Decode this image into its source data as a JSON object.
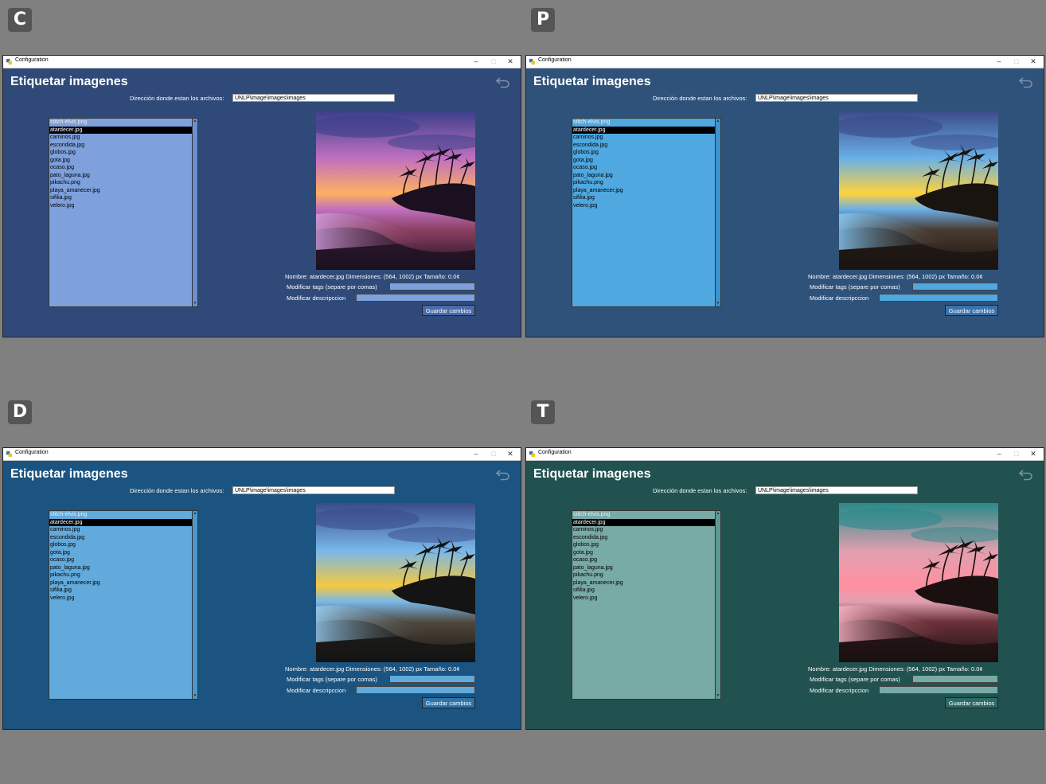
{
  "panels": [
    {
      "badge": "C",
      "colors": {
        "bg": "#2f4a78",
        "list": "#7ea0dd",
        "field": "#7ea0dd",
        "button": "#4a6aa8",
        "scroll": "#6b8fd2",
        "img_sky1": "#3a3f8a",
        "img_sky2": "#c070c0",
        "img_horizon": "#ffb060",
        "img_sand": "#8a4060",
        "img_dark": "#1a1020",
        "img_water": "#d0a0e0"
      }
    },
    {
      "badge": "P",
      "colors": {
        "bg": "#2f527a",
        "list": "#4fa8e0",
        "field": "#4fa8e0",
        "button": "#3a72aa",
        "scroll": "#3e93cc",
        "img_sky1": "#3b4a88",
        "img_sky2": "#6ab0e8",
        "img_horizon": "#ffd23c",
        "img_sand": "#4a3a30",
        "img_dark": "#1a1410",
        "img_water": "#8ad0ff"
      }
    },
    {
      "badge": "D",
      "colors": {
        "bg": "#1b5480",
        "list": "#62aadc",
        "field": "#62aadc",
        "button": "#2e74a8",
        "scroll": "#4d97cc",
        "img_sky1": "#3a4c8a",
        "img_sky2": "#78b8ea",
        "img_horizon": "#f5c840",
        "img_sand": "#50483c",
        "img_dark": "#141414",
        "img_water": "#9ad2f8"
      }
    },
    {
      "badge": "T",
      "colors": {
        "bg": "#215250",
        "list": "#78aaa6",
        "field": "#78aaa6",
        "button": "#2e6a66",
        "scroll": "#5e9894",
        "img_sky1": "#2a8a8a",
        "img_sky2": "#e0a0b0",
        "img_horizon": "#ff90a0",
        "img_sand": "#6a3038",
        "img_dark": "#1a1010",
        "img_water": "#ffb8c8"
      }
    }
  ],
  "window": {
    "title": "Configuration",
    "minimize": "–",
    "maximize": "□",
    "close": "✕"
  },
  "app": {
    "heading": "Etiquetar imagenes",
    "dir_label": "Dirección donde estan los archivos:",
    "dir_value": "UNLP\\image\\images\\images",
    "files": [
      "stitch-elvis.png",
      "atardecer.jpg",
      "caminos.jpg",
      "escondida.jpg",
      "globos.jpg",
      "gota.jpg",
      "ocaso.jpg",
      "pato_laguna.jpg",
      "pikachu.png",
      "playa_amanecer.jpg",
      "sifilia.jpg",
      "velero.jpg"
    ],
    "selected_index": 1,
    "info": "Nombre: atardecer.jpg   Dimensiones: (564, 1002) px   Tamaño: 0.0¢",
    "tags_label": "Modificar tags (separe por comas)",
    "desc_label": "Modificar descripccion",
    "save_label": "Guardar cambios",
    "icons": {
      "back": "back-arrow-icon",
      "app": "python-app-icon"
    }
  }
}
